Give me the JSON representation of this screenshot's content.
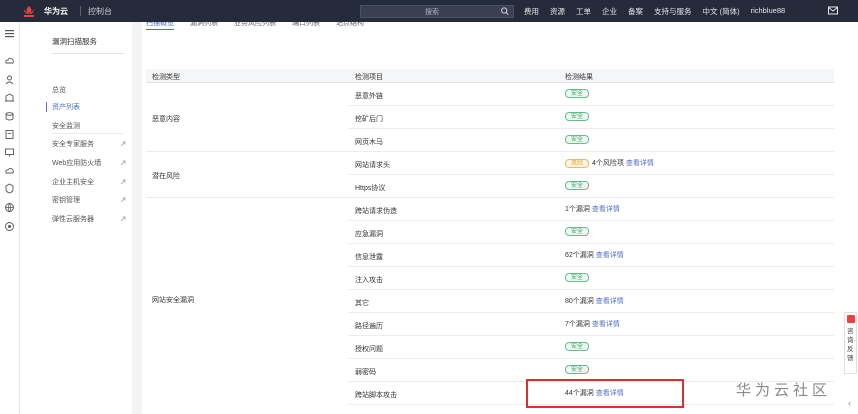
{
  "topbar": {
    "brand": "华为云",
    "console": "控制台",
    "search_placeholder": "搜索",
    "nav": [
      "费用",
      "资源",
      "工单",
      "企业",
      "备案",
      "支持与服务",
      "中文 (简体)",
      "richblue88"
    ]
  },
  "sidebar": {
    "title": "漏洞扫描服务",
    "items": [
      {
        "label": "总览"
      },
      {
        "label": "资产列表"
      },
      {
        "label": "安全监测"
      },
      {
        "label": "安全专家服务"
      },
      {
        "label": "Web应用防火墙"
      },
      {
        "label": "企业主机安全"
      },
      {
        "label": "密钥管理"
      },
      {
        "label": "弹性云服务器"
      }
    ]
  },
  "tabs": [
    "扫描概览",
    "漏洞列表",
    "业务风险列表",
    "端口列表",
    "站点结构"
  ],
  "table": {
    "headers": [
      "检测类型",
      "检测项目",
      "检测结果"
    ],
    "groups": [
      {
        "label": "恶意内容"
      },
      {
        "label": "潜在风险"
      },
      {
        "label": "网站安全漏洞"
      }
    ],
    "rows": [
      {
        "item": "恶意外链",
        "badge": "安全",
        "badge_type": "safe",
        "text": "",
        "link": ""
      },
      {
        "item": "挖矿后门",
        "badge": "安全",
        "badge_type": "safe",
        "text": "",
        "link": ""
      },
      {
        "item": "网页木马",
        "badge": "安全",
        "badge_type": "safe",
        "text": "",
        "link": ""
      },
      {
        "item": "网站请求头",
        "badge": "风险",
        "badge_type": "warn",
        "text": "4个风险项",
        "link": "查看详情"
      },
      {
        "item": "Https协议",
        "badge": "安全",
        "badge_type": "safe",
        "text": "",
        "link": ""
      },
      {
        "item": "跨站请求伪造",
        "badge": "",
        "badge_type": "",
        "text": "1个漏洞",
        "link": "查看详情"
      },
      {
        "item": "应急漏洞",
        "badge": "安全",
        "badge_type": "safe",
        "text": "",
        "link": ""
      },
      {
        "item": "信息泄露",
        "badge": "",
        "badge_type": "",
        "text": "62个漏洞",
        "link": "查看详情"
      },
      {
        "item": "注入攻击",
        "badge": "安全",
        "badge_type": "safe",
        "text": "",
        "link": ""
      },
      {
        "item": "其它",
        "badge": "",
        "badge_type": "",
        "text": "80个漏洞",
        "link": "查看详情"
      },
      {
        "item": "路径遍历",
        "badge": "",
        "badge_type": "",
        "text": "7个漏洞",
        "link": "查看详情"
      },
      {
        "item": "授权问题",
        "badge": "安全",
        "badge_type": "safe",
        "text": "",
        "link": ""
      },
      {
        "item": "弱密码",
        "badge": "安全",
        "badge_type": "safe",
        "text": "",
        "link": ""
      },
      {
        "item": "跨站脚本攻击",
        "badge": "",
        "badge_type": "",
        "text": "44个漏洞",
        "link": "查看详情"
      }
    ]
  },
  "feedback": {
    "label": "咨询·反馈"
  },
  "watermark": "华为云社区",
  "colors": {
    "topbar": "#252b3a",
    "accent": "#526ecc",
    "safe": "#3ba06a",
    "warn": "#f29b1c",
    "highlight": "#d9322e"
  }
}
